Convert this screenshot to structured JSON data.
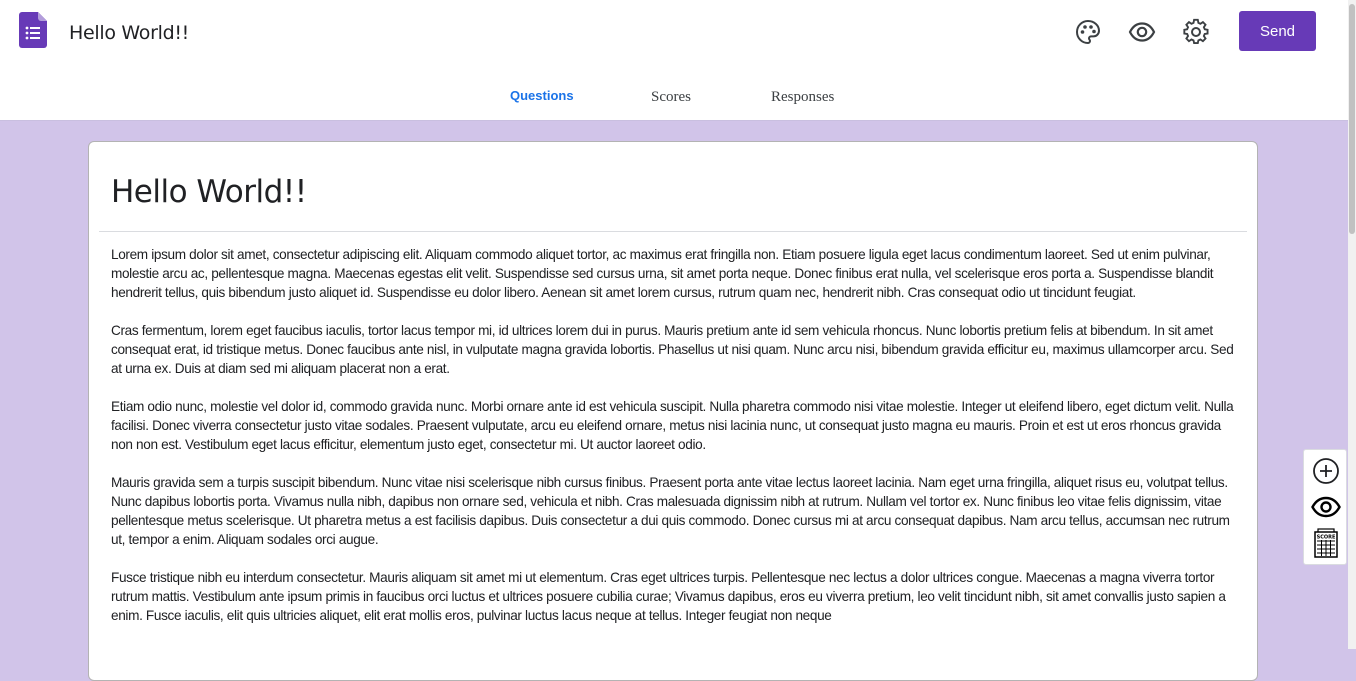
{
  "header": {
    "title": "Hello World!!",
    "send_label": "Send",
    "icons": [
      "palette-icon",
      "preview-eye-icon",
      "settings-gear-icon"
    ]
  },
  "tabs": [
    {
      "label": "Questions",
      "active": true
    },
    {
      "label": "Scores",
      "active": false
    },
    {
      "label": "Responses",
      "active": false
    }
  ],
  "form": {
    "title": "Hello World!!",
    "paragraphs": [
      "Lorem ipsum dolor sit amet, consectetur adipiscing elit. Aliquam commodo aliquet tortor, ac maximus erat fringilla non. Etiam posuere ligula eget lacus condimentum laoreet. Sed ut enim pulvinar, molestie arcu ac, pellentesque magna. Maecenas egestas elit velit. Suspendisse sed cursus urna, sit amet porta neque. Donec finibus erat nulla, vel scelerisque eros porta a. Suspendisse blandit hendrerit tellus, quis bibendum justo aliquet id. Suspendisse eu dolor libero. Aenean sit amet lorem cursus, rutrum quam nec, hendrerit nibh. Cras consequat odio ut tincidunt feugiat.",
      "Cras fermentum, lorem eget faucibus iaculis, tortor lacus tempor mi, id ultrices lorem dui in purus. Mauris pretium ante id sem vehicula rhoncus. Nunc lobortis pretium felis at bibendum. In sit amet consequat erat, id tristique metus. Donec faucibus ante nisl, in vulputate magna gravida lobortis. Phasellus ut nisi quam. Nunc arcu nisi, bibendum gravida efficitur eu, maximus ullamcorper arcu. Sed at urna ex. Duis at diam sed mi aliquam placerat non a erat.",
      "Etiam odio nunc, molestie vel dolor id, commodo gravida nunc. Morbi ornare ante id est vehicula suscipit. Nulla pharetra commodo nisi vitae molestie. Integer ut eleifend libero, eget dictum velit. Nulla facilisi. Donec viverra consectetur justo vitae sodales. Praesent vulputate, arcu eu eleifend ornare, metus nisi lacinia nunc, ut consequat justo magna eu mauris. Proin et est ut eros rhoncus gravida non non est. Vestibulum eget lacus efficitur, elementum justo eget, consectetur mi. Ut auctor laoreet odio.",
      "Mauris gravida sem a turpis suscipit bibendum. Nunc vitae nisi scelerisque nibh cursus finibus. Praesent porta ante vitae lectus laoreet lacinia. Nam eget urna fringilla, aliquet risus eu, volutpat tellus. Nunc dapibus lobortis porta. Vivamus nulla nibh, dapibus non ornare sed, vehicula et nibh. Cras malesuada dignissim nibh at rutrum. Nullam vel tortor ex. Nunc finibus leo vitae felis dignissim, vitae pellentesque metus scelerisque. Ut pharetra metus a est facilisis dapibus. Duis consectetur a dui quis commodo. Donec cursus mi at arcu consequat dapibus. Nam arcu tellus, accumsan nec rutrum ut, tempor a enim. Aliquam sodales orci augue.",
      "Fusce tristique nibh eu interdum consectetur. Mauris aliquam sit amet mi ut elementum. Cras eget ultrices turpis. Pellentesque nec lectus a dolor ultrices congue. Maecenas a magna viverra tortor rutrum mattis. Vestibulum ante ipsum primis in faucibus orci luctus et ultrices posuere cubilia curae; Vivamus dapibus, eros eu viverra pretium, leo velit tincidunt nibh, sit amet convallis justo sapien a enim. Fusce iaculis, elit quis ultricies aliquet, elit erat mollis eros, pulvinar luctus lacus neque at tellus. Integer feugiat non neque"
    ]
  },
  "side_toolbar": {
    "icons": [
      "add-circle-icon",
      "preview-eye-icon",
      "score-sheet-icon"
    ],
    "score_icon_text": "SCORE"
  },
  "colors": {
    "accent": "#673ab7",
    "background": "#d1c4e9",
    "tab_active": "#1a73e8"
  }
}
